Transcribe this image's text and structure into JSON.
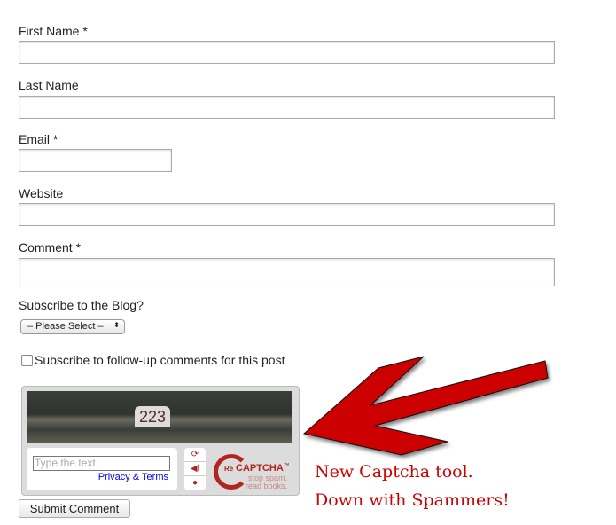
{
  "form": {
    "first_name_label": "First Name *",
    "last_name_label": "Last Name",
    "email_label": "Email *",
    "website_label": "Website",
    "comment_label": "Comment *",
    "subscribe_blog_label": "Subscribe to the Blog?",
    "subscribe_select_value": "– Please Select –",
    "followup_label": "Subscribe to follow-up comments for this post",
    "submit_label": "Submit Comment"
  },
  "captcha": {
    "image_text": "223",
    "placeholder": "Type the text",
    "privacy_link": "Privacy & Terms",
    "logo_re": "Re",
    "logo_name": "CAPTCHA",
    "logo_tm": "™",
    "tagline_1": "stop spam.",
    "tagline_2": "read books.",
    "icons": [
      "refresh-icon",
      "audio-icon",
      "help-icon"
    ],
    "brand_color": "#b0251e",
    "link_color": "#0000ee"
  },
  "annotation": {
    "line1": "New Captcha tool.",
    "line2": "Down with Spammers!",
    "color": "#cc0000"
  }
}
